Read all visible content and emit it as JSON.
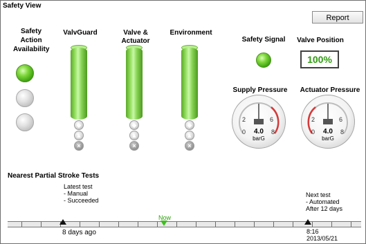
{
  "window": {
    "title": "Safety View"
  },
  "toolbar": {
    "report_label": "Report"
  },
  "availability": {
    "label_lines": [
      "Safety",
      "Action",
      "Availability"
    ],
    "leds": [
      "on",
      "off",
      "off"
    ]
  },
  "columns": [
    {
      "label": "ValvGuard",
      "level": 1.0
    },
    {
      "label": "Valve &\nActuator",
      "level": 1.0
    },
    {
      "label": "Environment",
      "level": 1.0
    }
  ],
  "safety_signal": {
    "label": "Safety Signal",
    "state": "on"
  },
  "valve_position": {
    "label": "Valve Position",
    "value": "100%"
  },
  "gauges": [
    {
      "label": "Supply Pressure",
      "value": "4.0",
      "unit": "barG",
      "ticks": [
        "0",
        "2",
        "4",
        "6",
        "8"
      ],
      "reading": 4.0
    },
    {
      "label": "Actuator Pressure",
      "value": "4.0",
      "unit": "barG",
      "ticks": [
        "0",
        "2",
        "4",
        "6",
        "8"
      ],
      "reading": 4.0
    }
  ],
  "stroke_tests": {
    "title": "Nearest Partial Stroke Tests",
    "latest": {
      "heading": "Latest test",
      "lines": [
        "- Manual",
        "- Succeeded"
      ],
      "when": "8 days ago"
    },
    "next": {
      "heading": "Next test",
      "lines": [
        "- Automated",
        "After 12 days"
      ],
      "time": "8:16",
      "date": "2013/05/21"
    },
    "now_label": "Now"
  },
  "colors": {
    "ok_green": "#39a00d",
    "value_green": "#2f9c10",
    "gauge_red": "#d43a3a"
  }
}
